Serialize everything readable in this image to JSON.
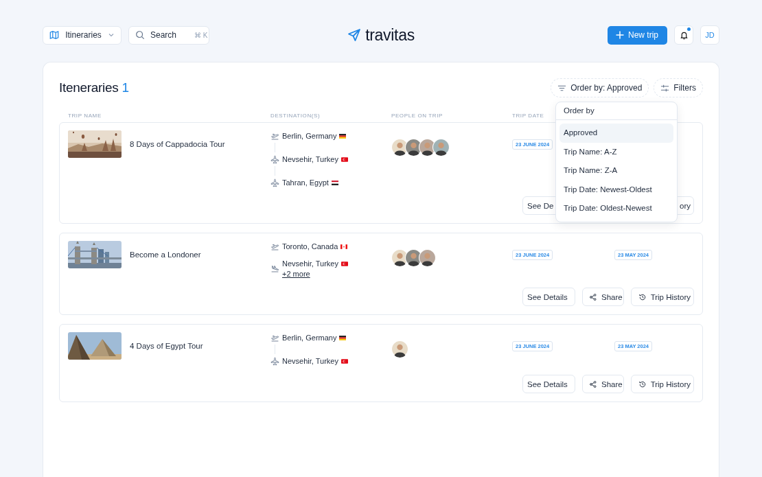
{
  "topbar": {
    "view_select": {
      "label": "Itineraries"
    },
    "search": {
      "placeholder": "Search",
      "shortcut": "⌘ K"
    },
    "logo": "travitas",
    "new_trip": "New trip",
    "notifications": {
      "unread": true
    },
    "avatar": "JD"
  },
  "page": {
    "title": "Iteneraries",
    "count": "1",
    "order_button": "Order by: Approved",
    "filters_button": "Filters"
  },
  "order_menu": {
    "title": "Order by",
    "options": [
      {
        "label": "Approved",
        "selected": true
      },
      {
        "label": "Trip Name: A-Z",
        "selected": false
      },
      {
        "label": "Trip Name: Z-A",
        "selected": false
      },
      {
        "label": "Trip Date: Newest-Oldest",
        "selected": false
      },
      {
        "label": "Trip Date: Oldest-Newest",
        "selected": false
      }
    ]
  },
  "table": {
    "columns": [
      "TRIP NAME",
      "DESTINATION(S)",
      "PEOPLE ON TRIP",
      "TRIP DATE"
    ],
    "rows": [
      {
        "image": {
          "kind": "picture"
        },
        "name": "8 Days of Cappadocia Tour",
        "stops": [
          {
            "kind": "departure",
            "place": "Berlin, Germany",
            "flag": {
              "kind": "de"
            }
          },
          {
            "kind": "stop",
            "place": "Nevsehir, Turkey",
            "flag": {
              "kind": "tr"
            }
          },
          {
            "kind": "stop",
            "place": "Tahran, Egypt",
            "flag": {
              "kind": "eg"
            }
          }
        ],
        "people": [
          {
            "kind": "avatar"
          },
          {
            "kind": "avatar"
          },
          {
            "kind": "avatar"
          },
          {
            "kind": "avatar"
          }
        ],
        "trip_date": "23 JUNE 2024",
        "actions": [
          {
            "kind": "details",
            "label": "See De"
          },
          {
            "kind": "history",
            "label": "ory",
            "icon": false
          }
        ]
      },
      {
        "image": {
          "kind": "picture"
        },
        "name": "Become a Londoner",
        "stops": [
          {
            "kind": "departure",
            "place": "Toronto, Canada",
            "flag": {
              "kind": "ca"
            }
          },
          {
            "kind": "arrival",
            "place": "Nevsehir, Turkey",
            "flag": {
              "kind": "tr"
            },
            "more": "+2 more"
          }
        ],
        "people": [
          {
            "kind": "avatar"
          },
          {
            "kind": "avatar"
          },
          {
            "kind": "avatar"
          }
        ],
        "trip_date": "23 JUNE 2024",
        "column_5": "23 MAY 2024",
        "actions": [
          {
            "kind": "details",
            "label": "See Details"
          },
          {
            "kind": "share",
            "label": "Share",
            "icon": true
          },
          {
            "kind": "history",
            "label": "Trip History",
            "icon": true
          }
        ]
      },
      {
        "image": {
          "kind": "picture"
        },
        "name": "4 Days of Egypt Tour",
        "stops": [
          {
            "kind": "departure",
            "place": "Berlin, Germany",
            "flag": {
              "kind": "de"
            }
          },
          {
            "kind": "stop",
            "place": "Nevsehir, Turkey",
            "flag": {
              "kind": "tr"
            }
          }
        ],
        "people": [
          {
            "kind": "avatar"
          }
        ],
        "trip_date": "23 JUNE 2024",
        "column_5": "23 MAY 2024",
        "actions": [
          {
            "kind": "details",
            "label": "See Details"
          },
          {
            "kind": "share",
            "label": "Share",
            "icon": true
          },
          {
            "kind": "history",
            "label": "Trip History",
            "icon": true
          }
        ]
      }
    ]
  }
}
